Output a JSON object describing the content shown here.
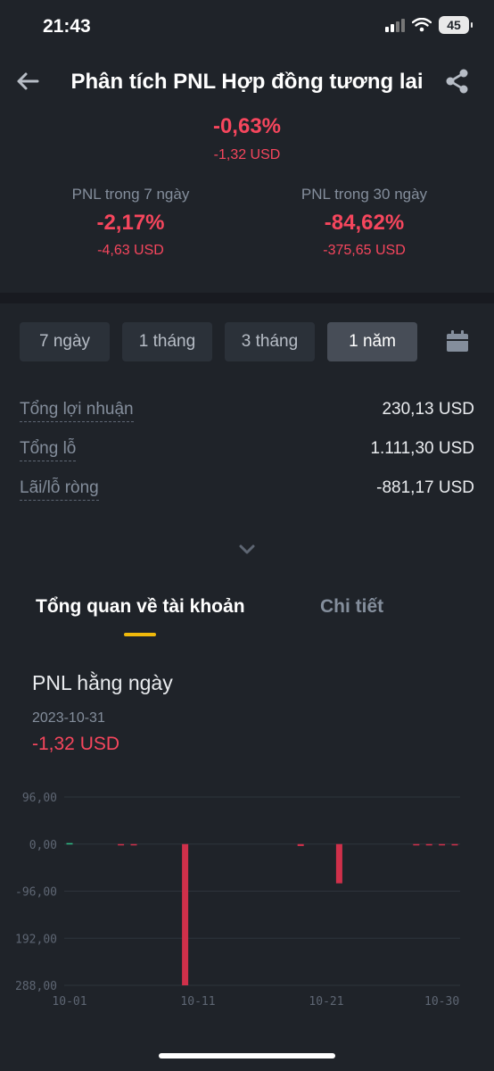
{
  "status_bar": {
    "time": "21:43",
    "battery": "45"
  },
  "header": {
    "title": "Phân tích PNL Hợp đồng tương lai"
  },
  "pnl_today": {
    "percent": "-0,63%",
    "usd": "-1,32 USD"
  },
  "pnl_7d": {
    "label": "PNL trong 7 ngày",
    "percent": "-2,17%",
    "usd": "-4,63 USD"
  },
  "pnl_30d": {
    "label": "PNL trong 30 ngày",
    "percent": "-84,62%",
    "usd": "-375,65 USD"
  },
  "periods": [
    "7 ngày",
    "1 tháng",
    "3 tháng",
    "1 năm"
  ],
  "active_period": "1 năm",
  "stats": [
    {
      "label": "Tổng lợi nhuận",
      "value": "230,13 USD"
    },
    {
      "label": "Tổng lỗ",
      "value": "1.111,30 USD"
    },
    {
      "label": "Lãi/lỗ ròng",
      "value": "-881,17 USD"
    }
  ],
  "tabs": {
    "account_overview": "Tổng quan về tài khoản",
    "details": "Chi tiết"
  },
  "daily_pnl": {
    "title": "PNL hằng ngày",
    "date": "2023-10-31",
    "value": "-1,32 USD"
  },
  "colors": {
    "background": "#1f2329",
    "negative": "#f6465d",
    "bar_negative": "#cf304a",
    "bar_positive": "#2ebd85",
    "accent": "#f0b90b"
  },
  "chart_data": {
    "type": "bar",
    "y_tick_labels": [
      "96,00",
      "0,00",
      "-96,00",
      "192,00",
      "288,00"
    ],
    "y_ticks": [
      96,
      0,
      -96,
      -192,
      -288
    ],
    "ylim": [
      -288,
      96
    ],
    "x_tick_labels": [
      "10-01",
      "10-11",
      "10-21",
      "10-30"
    ],
    "x_tick_days": [
      1,
      11,
      21,
      30
    ],
    "x_range_days": [
      1,
      31
    ],
    "days": [
      1,
      2,
      3,
      4,
      5,
      6,
      7,
      8,
      9,
      10,
      11,
      12,
      13,
      14,
      15,
      16,
      17,
      18,
      19,
      20,
      21,
      22,
      23,
      24,
      25,
      26,
      27,
      28,
      29,
      30,
      31
    ],
    "values": [
      2,
      0,
      0,
      0,
      -1,
      -1,
      0,
      0,
      0,
      -288,
      0,
      0,
      0,
      0,
      0,
      0,
      0,
      0,
      -4,
      0,
      0,
      -80,
      0,
      0,
      0,
      0,
      0,
      -1,
      -1,
      -1,
      -1
    ]
  }
}
